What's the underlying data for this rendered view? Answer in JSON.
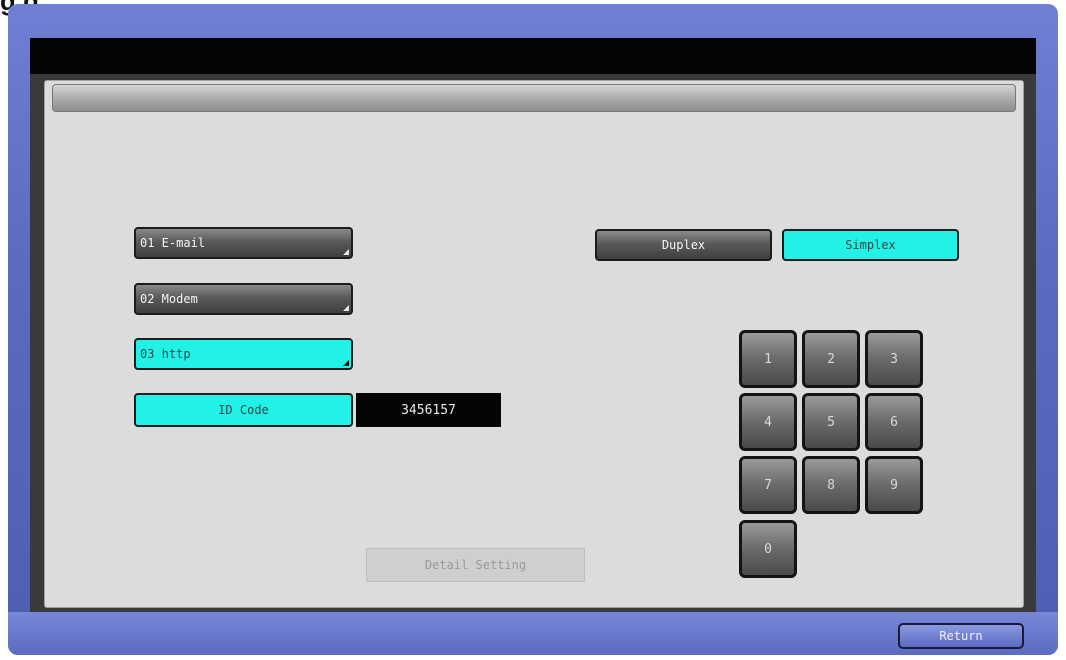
{
  "header": {
    "caption": "g   g"
  },
  "destinations": [
    {
      "label": "01 E-mail",
      "selected": false
    },
    {
      "label": "02 Modem",
      "selected": false
    },
    {
      "label": "03 http",
      "selected": true
    }
  ],
  "id_code": {
    "label": "ID Code",
    "value": "3456157"
  },
  "print_mode": {
    "duplex_label": "Duplex",
    "simplex_label": "Simplex",
    "selected": "Simplex"
  },
  "keypad": {
    "keys": [
      "1",
      "2",
      "3",
      "4",
      "5",
      "6",
      "7",
      "8",
      "9",
      "0"
    ]
  },
  "detail_setting": {
    "label": "Detail Setting",
    "enabled": false
  },
  "footer": {
    "return_label": "Return"
  },
  "colors": {
    "frame": "#5b6cc0",
    "selected": "#22f2e6",
    "panel": "#dcdcdc",
    "button_dark": "#5a5a5a"
  }
}
